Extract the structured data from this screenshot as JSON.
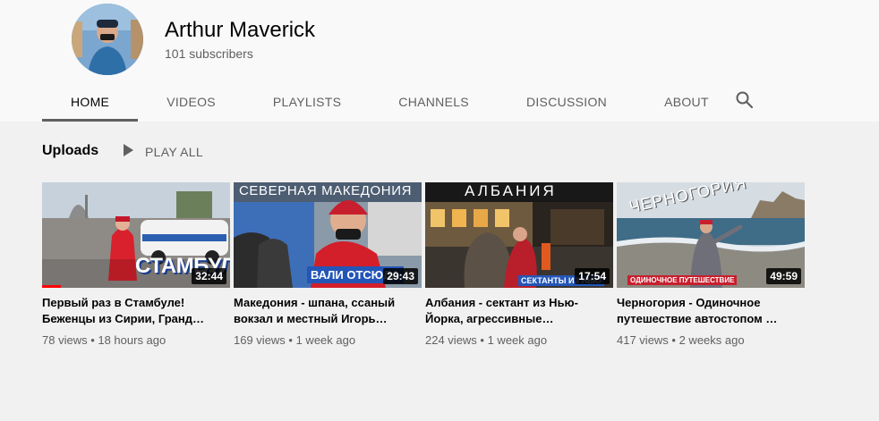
{
  "channel": {
    "name": "Arthur Maverick",
    "subscribers": "101 subscribers"
  },
  "tabs": [
    {
      "label": "HOME",
      "active": true
    },
    {
      "label": "VIDEOS",
      "active": false
    },
    {
      "label": "PLAYLISTS",
      "active": false
    },
    {
      "label": "CHANNELS",
      "active": false
    },
    {
      "label": "DISCUSSION",
      "active": false
    },
    {
      "label": "ABOUT",
      "active": false
    }
  ],
  "search_icon": "search-icon",
  "uploads": {
    "title": "Uploads",
    "play_all": "PLAY ALL",
    "play_icon": "play-icon"
  },
  "videos": [
    {
      "title": "Первый раз в Стамбуле! Беженцы из Сирии, Гранд…",
      "duration": "32:44",
      "views": "78 views",
      "age": "18 hours ago",
      "overlay_text": "СТАМБУЛ",
      "watched": 0.1
    },
    {
      "title": "Македония - шпана, ссаный вокзал и местный Игорь…",
      "duration": "29:43",
      "views": "169 views",
      "age": "1 week ago",
      "overlay_top": "СЕВЕРНАЯ МАКЕДОНИЯ",
      "overlay_text": "ВАЛИ ОТСЮДА"
    },
    {
      "title": "Албания - сектант из Нью-Йорка, агрессивные…",
      "duration": "17:54",
      "views": "224 views",
      "age": "1 week ago",
      "overlay_top": "АЛБАНИЯ",
      "overlay_text": "СЕКТАНТЫ ИЗ НЬЮ"
    },
    {
      "title": "Черногория - Одиночное путешествие автостопом …",
      "duration": "49:59",
      "views": "417 views",
      "age": "2 weeks ago",
      "overlay_top": "ЧЕРНОГОРИЯ",
      "overlay_text": "ОДИНОЧНОЕ ПУТЕШЕСТВИЕ"
    }
  ],
  "meta_separator": " • "
}
